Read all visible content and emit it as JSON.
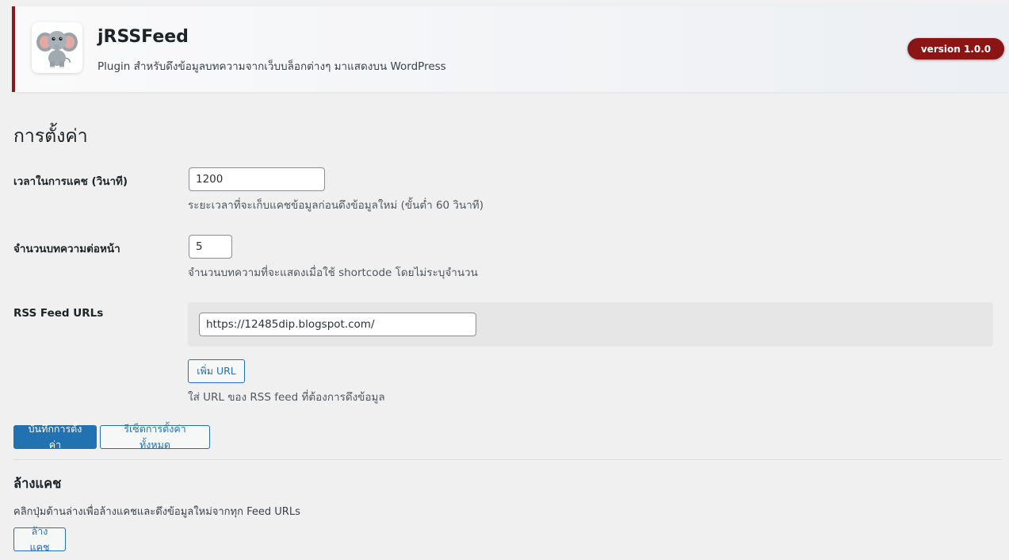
{
  "header": {
    "title": "jRSSFeed",
    "description": "Plugin สำหรับดึงข้อมูลบทความจากเว็บบล็อกต่างๆ มาแสดงบน WordPress",
    "version": "version 1.0.0",
    "logo_icon": "elephant-logo-icon"
  },
  "settings": {
    "heading": "การตั้งค่า",
    "cache_time": {
      "label": "เวลาในการแคช (วินาที)",
      "value": "1200",
      "help": "ระยะเวลาที่จะเก็บแคชข้อมูลก่อนดึงข้อมูลใหม่ (ขั้นต่ำ 60 วินาที)"
    },
    "posts_per_page": {
      "label": "จำนวนบทความต่อหน้า",
      "value": "5",
      "help": "จำนวนบทความที่จะแสดงเมื่อใช้ shortcode โดยไม่ระบุจำนวน"
    },
    "feed_urls": {
      "label": "RSS Feed URLs",
      "urls": [
        "https://12485dip.blogspot.com/"
      ],
      "add_button": "เพิ่ม URL",
      "help": "ใส่ URL ของ RSS feed ที่ต้องการดึงข้อมูล"
    },
    "save_button": "บันทึกการตั้งค่า",
    "reset_button": "รีเซ็ตการตั้งค่าทั้งหมด"
  },
  "cache": {
    "heading": "ล้างแคช",
    "description": "คลิกปุ่มด้านล่างเพื่อล้างแคชและดึงข้อมูลใหม่จากทุก Feed URLs",
    "clear_button": "ล้างแคช"
  },
  "colors": {
    "accent": "#8b1414",
    "primary": "#2271b1",
    "background": "#f0f0f1"
  }
}
